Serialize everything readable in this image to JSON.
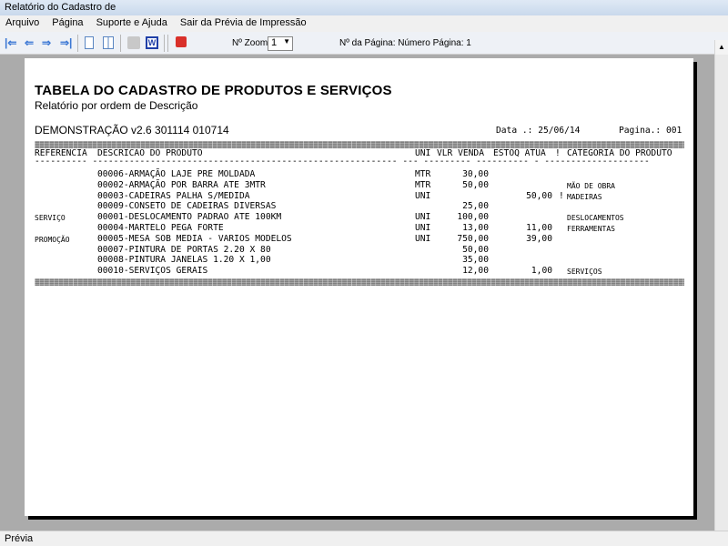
{
  "window": {
    "title": "Relatório do Cadastro de"
  },
  "menu": [
    "Arquivo",
    "Página",
    "Suporte e Ajuda",
    "Sair da Prévia de Impressão"
  ],
  "toolbar": {
    "zoom_label": "Nº Zoom",
    "zoom_value": "1",
    "page_label": "Nº da Página: Número Página: 1"
  },
  "report": {
    "title": "TABELA DO CADASTRO DE PRODUTOS E SERVIÇOS",
    "subtitle": "Relatório por ordem de Descrição",
    "company": "DEMONSTRAÇÃO v2.6 301114 010714",
    "date": "Data .: 25/06/14",
    "page": "Pagina.: 001",
    "columns": {
      "ref": "REFERENCIA",
      "desc": "DESCRICAO DO PRODUTO",
      "uni": "UNI",
      "vlr": "VLR VENDA",
      "estoq": "ESTOQ ATUA",
      "bang": "!",
      "cat": "CATEGORIA DO PRODUTO"
    },
    "rows": [
      {
        "ref": "",
        "desc": "00006-ARMAÇÃO LAJE PRE MOLDADA",
        "uni": "MTR",
        "vlr": "30,00",
        "estoq": "",
        "bang": "",
        "cat": ""
      },
      {
        "ref": "",
        "desc": "00002-ARMAÇÃO POR BARRA ATE 3MTR",
        "uni": "MTR",
        "vlr": "50,00",
        "estoq": "",
        "bang": "",
        "cat": "MÃO DE OBRA"
      },
      {
        "ref": "",
        "desc": "00003-CADEIRAS PALHA S/MEDIDA",
        "uni": "UNI",
        "vlr": "",
        "estoq": "50,00",
        "bang": "!",
        "cat": "MADEIRAS"
      },
      {
        "ref": "",
        "desc": "00009-CONSETO DE CADEIRAS DIVERSAS",
        "uni": "",
        "vlr": "25,00",
        "estoq": "",
        "bang": "",
        "cat": ""
      },
      {
        "ref": "SERVIÇO",
        "desc": "00001-DESLOCAMENTO PADRAO ATE 100KM",
        "uni": "UNI",
        "vlr": "100,00",
        "estoq": "",
        "bang": "",
        "cat": "DESLOCAMENTOS"
      },
      {
        "ref": "",
        "desc": "00004-MARTELO PEGA FORTE",
        "uni": "UNI",
        "vlr": "13,00",
        "estoq": "11,00",
        "bang": "",
        "cat": "FERRAMENTAS"
      },
      {
        "ref": "PROMOÇÃO",
        "desc": "00005-MESA SOB MEDIA - VARIOS MODELOS",
        "uni": "UNI",
        "vlr": "750,00",
        "estoq": "39,00",
        "bang": "",
        "cat": ""
      },
      {
        "ref": "",
        "desc": "00007-PINTURA DE PORTAS 2.20 X 80",
        "uni": "",
        "vlr": "50,00",
        "estoq": "",
        "bang": "",
        "cat": ""
      },
      {
        "ref": "",
        "desc": "00008-PINTURA JANELAS 1.20 X 1,00",
        "uni": "",
        "vlr": "35,00",
        "estoq": "",
        "bang": "",
        "cat": ""
      },
      {
        "ref": "",
        "desc": "00010-SERVIÇOS GERAIS",
        "uni": "",
        "vlr": "12,00",
        "estoq": "1,00",
        "bang": "",
        "cat": "SERVIÇOS"
      }
    ]
  },
  "status": {
    "text": "Prévia"
  }
}
